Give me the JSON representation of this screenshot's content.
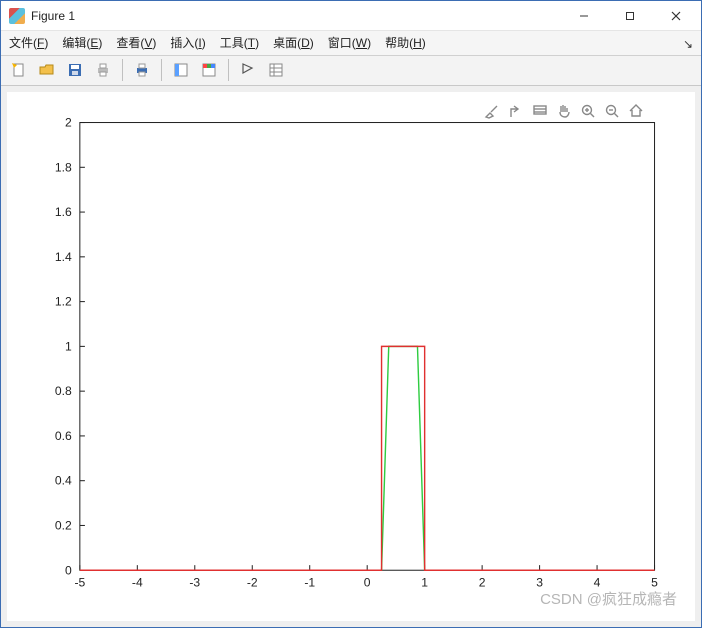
{
  "window": {
    "title": "Figure 1"
  },
  "menu": {
    "items": [
      {
        "label": "文件",
        "mn": "F"
      },
      {
        "label": "编辑",
        "mn": "E"
      },
      {
        "label": "查看",
        "mn": "V"
      },
      {
        "label": "插入",
        "mn": "I"
      },
      {
        "label": "工具",
        "mn": "T"
      },
      {
        "label": "桌面",
        "mn": "D"
      },
      {
        "label": "窗口",
        "mn": "W"
      },
      {
        "label": "帮助",
        "mn": "H"
      }
    ]
  },
  "toolbar_names": [
    "new",
    "open",
    "save",
    "print",
    "print-preview",
    "link-data",
    "color-bar",
    "edit-arrow",
    "insert-table"
  ],
  "axes_tool_names": [
    "brush",
    "rotate",
    "data-tips",
    "pan",
    "zoom-in",
    "zoom-out",
    "home"
  ],
  "watermark": "CSDN @疯狂成瘾者",
  "chart_data": {
    "type": "line",
    "xlabel": "",
    "ylabel": "",
    "xlim": [
      -5,
      5
    ],
    "ylim": [
      0,
      2
    ],
    "xticks": [
      -5,
      -4,
      -3,
      -2,
      -1,
      0,
      1,
      2,
      3,
      4,
      5
    ],
    "yticks": [
      0,
      0.2,
      0.4,
      0.6,
      0.8,
      1,
      1.2,
      1.4,
      1.6,
      1.8,
      2
    ],
    "series": [
      {
        "name": "green",
        "color": "#2ecc40",
        "x": [
          -5,
          0.25,
          0.375,
          0.875,
          1.0,
          5
        ],
        "y": [
          0,
          0,
          1,
          1,
          0,
          0
        ]
      },
      {
        "name": "red",
        "color": "#e03030",
        "x": [
          -5,
          0.25,
          0.25,
          1.0,
          1.0,
          5
        ],
        "y": [
          0,
          0,
          1,
          1,
          0,
          0
        ]
      }
    ]
  }
}
